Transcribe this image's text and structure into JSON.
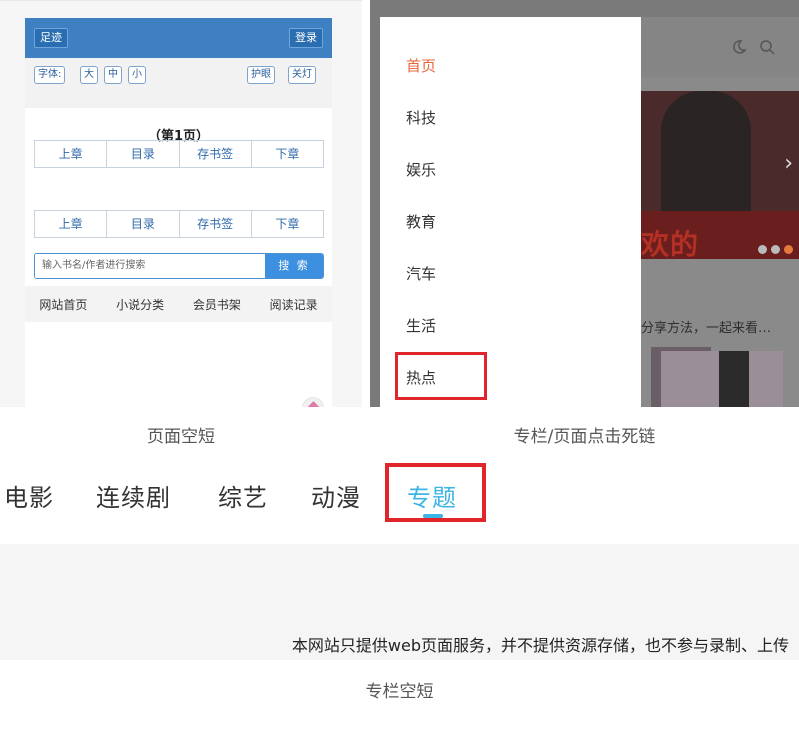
{
  "reader": {
    "footprint_label": "足迹",
    "login_label": "登录",
    "font_label": "字体:",
    "font_large": "大",
    "font_medium": "中",
    "font_small": "小",
    "eye_protect": "护眼",
    "light_off": "关灯",
    "page_title": "（第1页）",
    "nav_top": [
      "上章",
      "目录",
      "存书签",
      "下章"
    ],
    "nav_bottom": [
      "上章",
      "目录",
      "存书签",
      "下章"
    ],
    "search_placeholder": "输入书名/作者进行搜索",
    "search_button": "搜 索",
    "footer_nav": [
      "网站首页",
      "小说分类",
      "会员书架",
      "阅读记录"
    ]
  },
  "caption1": "页面空短",
  "side_menu": {
    "items": [
      "首页",
      "科技",
      "娱乐",
      "教育",
      "汽车",
      "生活",
      "热点"
    ],
    "active_index": 0,
    "highlighted_item": "热点",
    "banner_text": "欢的",
    "teaser_text": "分享方法，一起来看…",
    "icons": [
      "moon-icon",
      "search-icon",
      "chevron-right-icon"
    ],
    "colors": {
      "active": "#e8673a",
      "highlight": "#e0262a"
    }
  },
  "caption2": "专栏/页面点击死链",
  "video_tabs": {
    "items": [
      "电影",
      "连续剧",
      "综艺",
      "动漫",
      "专题"
    ],
    "active_tab": "专题",
    "colors": {
      "active": "#3bb4e6",
      "highlight": "#e0262a"
    }
  },
  "disclaimer": "本网站只提供web页面服务，并不提供资源存储，也不参与录制、上传",
  "caption3": "专栏空短"
}
